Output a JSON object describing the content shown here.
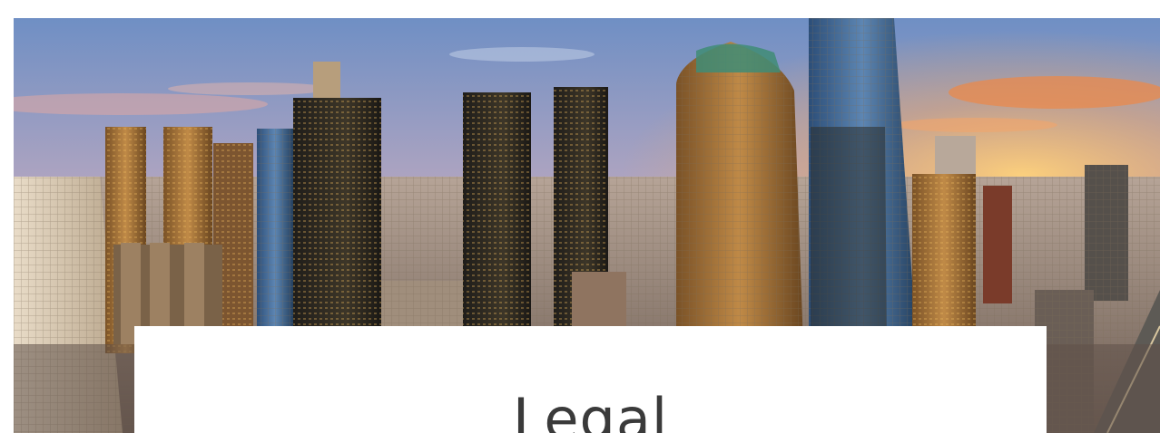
{
  "hero": {
    "image_subject": "city-skyline-image",
    "colors": {
      "sky_top": "#6f8fc4",
      "sky_mid": "#c8a6b4",
      "sky_horizon": "#f3b36a",
      "sun_glow": "#ffce6a",
      "city_haze": "#b9a79c",
      "tower_dark": "#2d2a25",
      "tower_gold": "#a9743c",
      "tower_glass": "#3b5f86"
    }
  },
  "content": {
    "title": "Legal"
  }
}
